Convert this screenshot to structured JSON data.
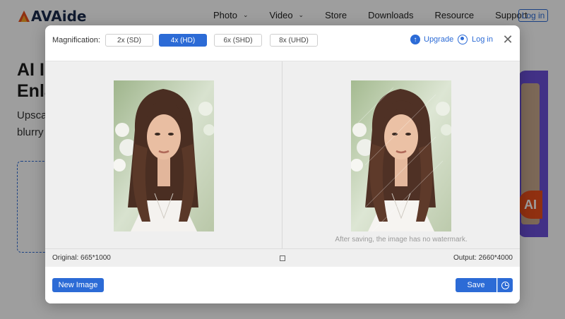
{
  "site": {
    "logo_text": "AVAide",
    "nav": [
      "Photo",
      "Video",
      "Store",
      "Downloads",
      "Resource",
      "Support"
    ],
    "nav_dropdowns": [
      true,
      true,
      false,
      false,
      false,
      false
    ],
    "login": "Log in",
    "hero_title_lines": [
      "AI I",
      "Enla"
    ],
    "hero_sub_lines": [
      "Upsca",
      "blurry"
    ],
    "hero_badge": "AI"
  },
  "modal": {
    "magnification_label": "Magnification:",
    "options": [
      "2x (SD)",
      "4x (HD)",
      "6x (SHD)",
      "8x (UHD)"
    ],
    "selected_option": "4x (HD)",
    "upgrade": "Upgrade",
    "login": "Log in",
    "watermark_note": "After saving, the image has no watermark.",
    "original": "Original: 665*1000",
    "output": "Output: 2660*4000",
    "new_image": "New Image",
    "save": "Save"
  },
  "colors": {
    "accent": "#2c6bd6",
    "brand_dark": "#1a2b4c",
    "hero_panel": "#6b4fd8",
    "badge": "#e94e1b"
  },
  "icons": {
    "upgrade": "upload-arrow-icon",
    "login": "user-icon",
    "close": "close-icon",
    "compare": "compare-square-icon",
    "history": "clock-icon"
  }
}
